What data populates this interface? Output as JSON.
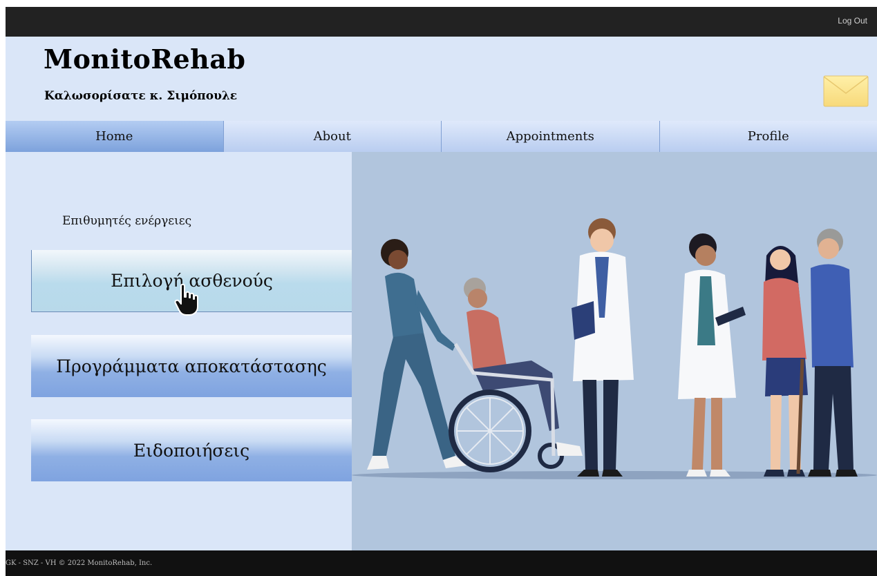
{
  "topbar": {
    "logout_label": "Log Out"
  },
  "header": {
    "app_title": "MonitoRehab",
    "welcome": "Καλωσορίσατε κ. Σιμόπουλε",
    "mail_icon": "envelope-icon"
  },
  "nav": {
    "items": [
      {
        "label": "Home",
        "active": true
      },
      {
        "label": "About"
      },
      {
        "label": "Appointments"
      },
      {
        "label": "Profile"
      }
    ]
  },
  "main": {
    "actions_title": "Επιθυμητές ενέργειες",
    "buttons": [
      {
        "label": "Επιλογή ασθενούς"
      },
      {
        "label": "Προγράμματα αποκατάστασης"
      },
      {
        "label": "Ειδοποιήσεις"
      }
    ],
    "cursor_icon": "hand-pointer-icon",
    "illustration": "medical-team-illustration"
  },
  "footer": {
    "text": "GK - SNZ - VH © 2022 MonitoRehab, Inc."
  },
  "colors": {
    "topbar": "#222222",
    "page_bg": "#dae6f8",
    "nav_active": "#7da2dc",
    "illustration_bg": "#b1c5dd",
    "footer": "#111111"
  }
}
